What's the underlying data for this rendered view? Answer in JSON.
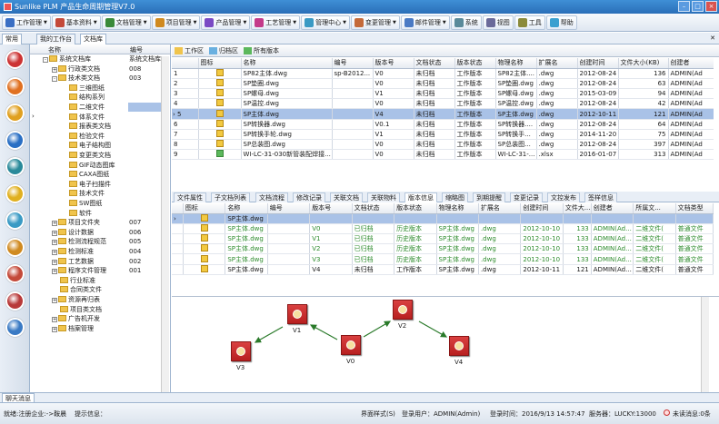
{
  "window": {
    "title": "Sunlike PLM 产品生命周期管理V7.0"
  },
  "menu": [
    {
      "label": "工作管理",
      "color": "#3a6fc4"
    },
    {
      "label": "基本资料",
      "color": "#c44a3a"
    },
    {
      "label": "文档管理",
      "color": "#3a8a3a"
    },
    {
      "label": "项目管理",
      "color": "#d08a20"
    },
    {
      "label": "产品管理",
      "color": "#7a4ac4"
    },
    {
      "label": "工艺管理",
      "color": "#c43a8a"
    },
    {
      "label": "管理中心",
      "color": "#3a9ac4"
    },
    {
      "label": "变更管理",
      "color": "#c46a3a"
    },
    {
      "label": "邮件管理",
      "color": "#4a7ac4"
    },
    {
      "label": "系统",
      "color": "#5a8a9a"
    },
    {
      "label": "视图",
      "color": "#6a6a9a"
    },
    {
      "label": "工具",
      "color": "#8a8a3a"
    },
    {
      "label": "帮助",
      "color": "#3aa0d0"
    }
  ],
  "tabs": {
    "common": "常用",
    "workbench": "我的工作台",
    "doclib": "文档库"
  },
  "tree": {
    "col_name": "名称",
    "col_code": "编号",
    "rows": [
      {
        "label": "系统文档库",
        "code": "系统文档库",
        "indent": 1,
        "pm": "-"
      },
      {
        "label": "行政类文档",
        "code": "008",
        "indent": 2,
        "pm": "+"
      },
      {
        "label": "技术类文档",
        "code": "003",
        "indent": 2,
        "pm": "-"
      },
      {
        "label": "三维图纸",
        "code": "",
        "indent": 3,
        "pm": ""
      },
      {
        "label": "结构系列",
        "code": "",
        "indent": 3,
        "pm": ""
      },
      {
        "label": "二维文件",
        "code": "",
        "indent": 3,
        "pm": "",
        "sel": true
      },
      {
        "label": "体系文件",
        "code": "",
        "indent": 3,
        "pm": ""
      },
      {
        "label": "报表类文档",
        "code": "",
        "indent": 3,
        "pm": ""
      },
      {
        "label": "检验文件",
        "code": "",
        "indent": 3,
        "pm": ""
      },
      {
        "label": "电子结构图",
        "code": "",
        "indent": 3,
        "pm": ""
      },
      {
        "label": "变更类文档",
        "code": "",
        "indent": 3,
        "pm": ""
      },
      {
        "label": "GIF动态图库",
        "code": "",
        "indent": 3,
        "pm": ""
      },
      {
        "label": "CAXA图纸",
        "code": "",
        "indent": 3,
        "pm": ""
      },
      {
        "label": "电子扫描件",
        "code": "",
        "indent": 3,
        "pm": ""
      },
      {
        "label": "技术文件",
        "code": "",
        "indent": 3,
        "pm": ""
      },
      {
        "label": "SW图纸",
        "code": "",
        "indent": 3,
        "pm": ""
      },
      {
        "label": "软件",
        "code": "",
        "indent": 3,
        "pm": ""
      },
      {
        "label": "项目文件夹",
        "code": "007",
        "indent": 2,
        "pm": "+"
      },
      {
        "label": "设计数据",
        "code": "006",
        "indent": 2,
        "pm": "+"
      },
      {
        "label": "检测流程规范",
        "code": "005",
        "indent": 2,
        "pm": "+"
      },
      {
        "label": "检测标准",
        "code": "004",
        "indent": 2,
        "pm": "+"
      },
      {
        "label": "工艺数据",
        "code": "002",
        "indent": 2,
        "pm": "+"
      },
      {
        "label": "程序文件管理",
        "code": "001",
        "indent": 2,
        "pm": "+"
      },
      {
        "label": "行业标准",
        "code": "",
        "indent": 2,
        "pm": ""
      },
      {
        "label": "合同类文件",
        "code": "",
        "indent": 2,
        "pm": ""
      },
      {
        "label": "资源再归表",
        "code": "",
        "indent": 2,
        "pm": "+"
      },
      {
        "label": "项目类文档",
        "code": "",
        "indent": 2,
        "pm": ""
      },
      {
        "label": "广告机开发",
        "code": "",
        "indent": 2,
        "pm": "+"
      },
      {
        "label": "档案管理",
        "code": "",
        "indent": 2,
        "pm": "+"
      }
    ]
  },
  "toolbar": {
    "workarea": "工作区",
    "archive": "归档区",
    "allversions": "所有版本"
  },
  "grid1": {
    "headers": [
      "",
      "图标",
      "名称",
      "编号",
      "版本号",
      "文档状态",
      "版本状态",
      "物理名称",
      "扩展名",
      "创建时间",
      "文件大小(KB)",
      "创建者"
    ],
    "rows": [
      {
        "n": "1",
        "icon": "dwg",
        "name": "SP82主体.dwg",
        "code": "sp-B2012...",
        "ver": "V0",
        "dstat": "未归档",
        "vstat": "工作版本",
        "phys": "SP82主体....",
        "ext": ".dwg",
        "time": "2012-08-24",
        "size": "136",
        "creator": "ADMIN(Ad"
      },
      {
        "n": "2",
        "icon": "dwg",
        "name": "SP垫圈.dwg",
        "code": "",
        "ver": "V0",
        "dstat": "未归档",
        "vstat": "工作版本",
        "phys": "SP垫圈.dwg",
        "ext": ".dwg",
        "time": "2012-08-24",
        "size": "63",
        "creator": "ADMIN(Ad"
      },
      {
        "n": "3",
        "icon": "dwg",
        "name": "SP螺母.dwg",
        "code": "",
        "ver": "V1",
        "dstat": "未归档",
        "vstat": "工作版本",
        "phys": "SP螺母.dwg",
        "ext": ".dwg",
        "time": "2015-03-09",
        "size": "94",
        "creator": "ADMIN(Ad"
      },
      {
        "n": "4",
        "icon": "dwg",
        "name": "SP温控.dwg",
        "code": "",
        "ver": "V0",
        "dstat": "未归档",
        "vstat": "工作版本",
        "phys": "SP温控.dwg",
        "ext": ".dwg",
        "time": "2012-08-24",
        "size": "42",
        "creator": "ADMIN(Ad"
      },
      {
        "n": "5",
        "icon": "dwg",
        "name": "SP主体.dwg",
        "code": "",
        "ver": "V4",
        "dstat": "未归档",
        "vstat": "工作版本",
        "phys": "SP主体.dwg",
        "ext": ".dwg",
        "time": "2012-10-11",
        "size": "121",
        "creator": "ADMIN(Ad",
        "sel": true
      },
      {
        "n": "6",
        "icon": "dwg",
        "name": "SP转换器.dwg",
        "code": "",
        "ver": "V0.1",
        "dstat": "未归档",
        "vstat": "工作版本",
        "phys": "SP转换器....",
        "ext": ".dwg",
        "time": "2012-08-24",
        "size": "64",
        "creator": "ADMIN(Ad"
      },
      {
        "n": "7",
        "icon": "dwg",
        "name": "SP转换手轮.dwg",
        "code": "",
        "ver": "V1",
        "dstat": "未归档",
        "vstat": "工作版本",
        "phys": "SP转换手...",
        "ext": ".dwg",
        "time": "2014-11-20",
        "size": "75",
        "creator": "ADMIN(Ad"
      },
      {
        "n": "8",
        "icon": "dwg",
        "name": "SP总装图.dwg",
        "code": "",
        "ver": "V0",
        "dstat": "未归档",
        "vstat": "工作版本",
        "phys": "SP总装图...",
        "ext": ".dwg",
        "time": "2012-08-24",
        "size": "397",
        "creator": "ADMIN(Ad"
      },
      {
        "n": "9",
        "icon": "xls",
        "name": "WI-LC-31-030新管装配焊接...",
        "code": "",
        "ver": "V0",
        "dstat": "未归档",
        "vstat": "工作版本",
        "phys": "WI-LC-31-...",
        "ext": ".xlsx",
        "time": "2016-01-07",
        "size": "313",
        "creator": "ADMIN(Ad"
      }
    ]
  },
  "subtabs": [
    "文件属性",
    "子文档列表",
    "文档流程",
    "修改记录",
    "关联文档",
    "关联物料",
    "版本信息",
    "缩略图",
    "到期提醒",
    "变更记录",
    "文控发布",
    "签样信息"
  ],
  "subtabs_active": 6,
  "grid2": {
    "headers": [
      "",
      "图标",
      "名称",
      "编号",
      "版本号",
      "文档状态",
      "版本状态",
      "物理名称",
      "扩展名",
      "创建时间",
      "文件大...",
      "创建者",
      "所属文...",
      "文档类型"
    ],
    "rows": [
      {
        "icon": "dwg",
        "name": "SP主体.dwg",
        "code": "",
        "ver": "",
        "dstat": "",
        "vstat": "",
        "phys": "",
        "ext": "",
        "time": "",
        "size": "",
        "creator": "",
        "cat": "",
        "type": "",
        "sel": true,
        "green": false
      },
      {
        "icon": "dwg",
        "name": "SP主体.dwg",
        "code": "",
        "ver": "V0",
        "dstat": "已归档",
        "vstat": "历史版本",
        "phys": "SP主体.dwg",
        "ext": ".dwg",
        "time": "2012-10-10",
        "size": "133",
        "creator": "ADMIN(Ad...",
        "cat": "二维文件(",
        "type": "普通文件",
        "green": true
      },
      {
        "icon": "dwg",
        "name": "SP主体.dwg",
        "code": "",
        "ver": "V1",
        "dstat": "已归档",
        "vstat": "历史版本",
        "phys": "SP主体.dwg",
        "ext": ".dwg",
        "time": "2012-10-10",
        "size": "133",
        "creator": "ADMIN(Ad...",
        "cat": "二维文件(",
        "type": "普通文件",
        "green": true
      },
      {
        "icon": "dwg",
        "name": "SP主体.dwg",
        "code": "",
        "ver": "V2",
        "dstat": "已归档",
        "vstat": "历史版本",
        "phys": "SP主体.dwg",
        "ext": ".dwg",
        "time": "2012-10-10",
        "size": "133",
        "creator": "ADMIN(Ad...",
        "cat": "二维文件(",
        "type": "普通文件",
        "green": true
      },
      {
        "icon": "dwg",
        "name": "SP主体.dwg",
        "code": "",
        "ver": "V3",
        "dstat": "已归档",
        "vstat": "历史版本",
        "phys": "SP主体.dwg",
        "ext": ".dwg",
        "time": "2012-10-10",
        "size": "133",
        "creator": "ADMIN(Ad...",
        "cat": "二维文件(",
        "type": "普通文件",
        "green": true
      },
      {
        "icon": "dwg",
        "name": "SP主体.dwg",
        "code": "",
        "ver": "V4",
        "dstat": "未归档",
        "vstat": "工作版本",
        "phys": "SP主体.dwg",
        "ext": ".dwg",
        "time": "2012-10-11",
        "size": "121",
        "creator": "ADMIN(Ad...",
        "cat": "二维文件(",
        "type": "普通文件",
        "green": false
      }
    ]
  },
  "flow": {
    "nodes": [
      "V1",
      "V2",
      "V3",
      "V0",
      "V4"
    ]
  },
  "message_tab": "聊天消息",
  "status": {
    "left": "就绪:注册企业:->鞍晨",
    "prompt": "提示信息：",
    "style": "界面样式(S)",
    "user": "登录用户：ADMIN(Admin)",
    "time": "登录时间：2016/9/13 14:57:47",
    "server": "服务器：LUCKY:13000",
    "unread": "未读消息:0条"
  }
}
